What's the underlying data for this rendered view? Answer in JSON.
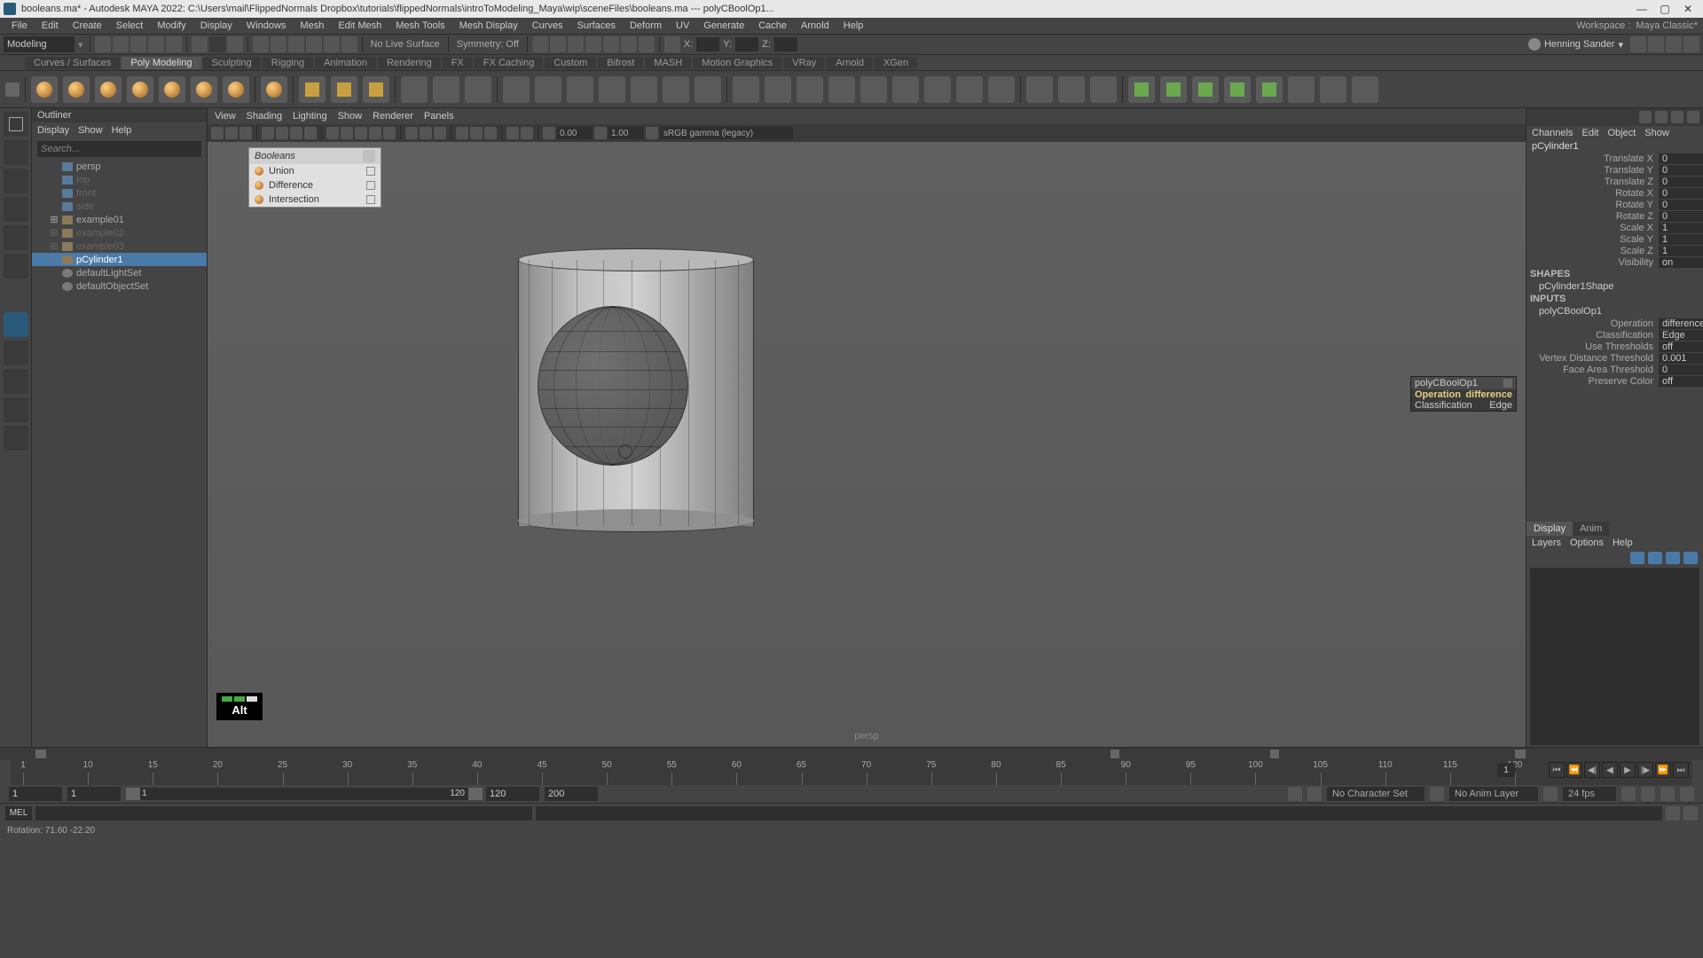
{
  "title": "booleans.ma* - Autodesk MAYA 2022: C:\\Users\\mail\\FlippedNormals Dropbox\\tutorials\\flippedNormals\\introToModeling_Maya\\wip\\sceneFiles\\booleans.ma   ---   polyCBoolOp1...",
  "menu_bar": [
    "File",
    "Edit",
    "Create",
    "Select",
    "Modify",
    "Display",
    "Windows",
    "Mesh",
    "Edit Mesh",
    "Mesh Tools",
    "Mesh Display",
    "Curves",
    "Surfaces",
    "Deform",
    "UV",
    "Generate",
    "Cache",
    "Arnold",
    "Help"
  ],
  "workspace_label": "Workspace :",
  "workspace_value": "Maya Classic*",
  "mode_dropdown": "Modeling",
  "live_surface": "No Live Surface",
  "symmetry": "Symmetry: Off",
  "xyz": {
    "x": "X:",
    "y": "Y:",
    "z": "Z:"
  },
  "user_name": "Henning Sander",
  "shelf_tabs": [
    "Curves / Surfaces",
    "Poly Modeling",
    "Sculpting",
    "Rigging",
    "Animation",
    "Rendering",
    "FX",
    "FX Caching",
    "Custom",
    "Bifrost",
    "MASH",
    "Motion Graphics",
    "VRay",
    "Arnold",
    "XGen"
  ],
  "active_shelf_tab": 1,
  "outliner": {
    "title": "Outliner",
    "menus": [
      "Display",
      "Show",
      "Help"
    ],
    "search_placeholder": "Search...",
    "items": [
      {
        "label": "persp",
        "type": "camera",
        "dim": false
      },
      {
        "label": "top",
        "type": "camera",
        "dim": true
      },
      {
        "label": "front",
        "type": "camera",
        "dim": true
      },
      {
        "label": "side",
        "type": "camera",
        "dim": true
      },
      {
        "label": "example01",
        "type": "mesh",
        "expandable": true,
        "dim": false
      },
      {
        "label": "example02",
        "type": "mesh",
        "expandable": true,
        "dim": true
      },
      {
        "label": "example03",
        "type": "mesh",
        "expandable": true,
        "dim": true
      },
      {
        "label": "pCylinder1",
        "type": "mesh",
        "dim": false,
        "selected": true
      },
      {
        "label": "defaultLightSet",
        "type": "set",
        "dim": false
      },
      {
        "label": "defaultObjectSet",
        "type": "set",
        "dim": false
      }
    ]
  },
  "panel_menus": [
    "View",
    "Shading",
    "Lighting",
    "Show",
    "Renderer",
    "Panels"
  ],
  "panel_fields": {
    "near": "0.00",
    "far": "1.00"
  },
  "gamma_dropdown": "sRGB gamma (legacy)",
  "bool_panel": {
    "title": "Booleans",
    "items": [
      "Union",
      "Difference",
      "Intersection"
    ]
  },
  "key_indicator": "Alt",
  "persp_label": "persp",
  "hud": {
    "node": "polyCBoolOp1",
    "rows": [
      {
        "k": "Operation",
        "v": "difference",
        "hl": true
      },
      {
        "k": "Classification",
        "v": "Edge",
        "hl": false
      }
    ]
  },
  "channel_box": {
    "menus": [
      "Channels",
      "Edit",
      "Object",
      "Show"
    ],
    "node_name": "pCylinder1",
    "transforms": [
      {
        "k": "Translate X",
        "v": "0"
      },
      {
        "k": "Translate Y",
        "v": "0"
      },
      {
        "k": "Translate Z",
        "v": "0"
      },
      {
        "k": "Rotate X",
        "v": "0"
      },
      {
        "k": "Rotate Y",
        "v": "0"
      },
      {
        "k": "Rotate Z",
        "v": "0"
      },
      {
        "k": "Scale X",
        "v": "1"
      },
      {
        "k": "Scale Y",
        "v": "1"
      },
      {
        "k": "Scale Z",
        "v": "1"
      },
      {
        "k": "Visibility",
        "v": "on"
      }
    ],
    "shapes_label": "SHAPES",
    "shape_node": "pCylinder1Shape",
    "inputs_label": "INPUTS",
    "input_node": "polyCBoolOp1",
    "input_attrs": [
      {
        "k": "Operation",
        "v": "difference"
      },
      {
        "k": "Classification",
        "v": "Edge"
      },
      {
        "k": "Use Thresholds",
        "v": "off"
      },
      {
        "k": "Vertex Distance Threshold",
        "v": "0.001"
      },
      {
        "k": "Face Area Threshold",
        "v": "0"
      },
      {
        "k": "Preserve Color",
        "v": "off"
      }
    ]
  },
  "layers": {
    "tabs": [
      "Display",
      "Anim"
    ],
    "menus": [
      "Layers",
      "Options",
      "Help"
    ]
  },
  "timeline": {
    "current_frame": "1",
    "ticks": [
      "1",
      "10",
      "15",
      "20",
      "25",
      "30",
      "35",
      "40",
      "45",
      "50",
      "55",
      "60",
      "65",
      "70",
      "75",
      "80",
      "85",
      "90",
      "95",
      "100",
      "105",
      "110",
      "115",
      "120"
    ]
  },
  "range": {
    "start_outer": "1",
    "start_inner": "1",
    "slider_start": "1",
    "slider_end": "120",
    "end_inner": "120",
    "end_outer": "200",
    "char_set": "No Character Set",
    "anim_layer": "No Anim Layer",
    "fps": "24 fps"
  },
  "cmd_label": "MEL",
  "help_line": "Rotation:    71.60      -22.20"
}
